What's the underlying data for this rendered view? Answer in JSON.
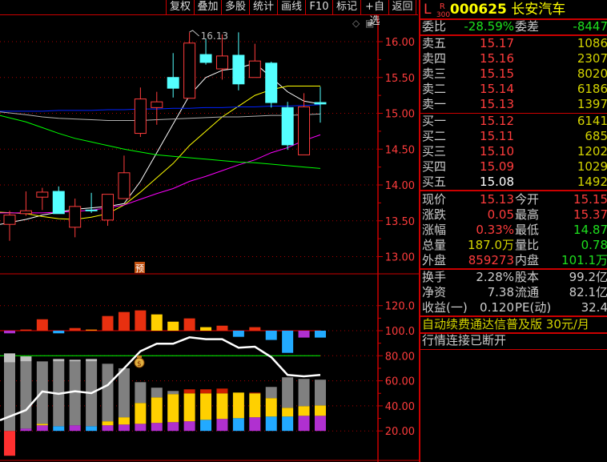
{
  "toolbar": {
    "buttons": [
      "复权",
      "叠加",
      "多股",
      "统计",
      "画线",
      "F10",
      "标记",
      "+自选",
      "返回"
    ]
  },
  "chart_icons": {
    "diamond": "◇",
    "layout": "▣"
  },
  "quote": {
    "prefix_l": "L",
    "prefix_r": "R",
    "prefix_300": "300",
    "code": "000625",
    "name": "长安汽车",
    "weibi_label": "委比",
    "weibi": "-28.59%",
    "weicha_label": "委差",
    "weicha": "-8447",
    "asks": [
      {
        "label": "卖五",
        "price": "15.17",
        "vol": "1086"
      },
      {
        "label": "卖四",
        "price": "15.16",
        "vol": "2307"
      },
      {
        "label": "卖三",
        "price": "15.15",
        "vol": "8020"
      },
      {
        "label": "卖二",
        "price": "15.14",
        "vol": "6186"
      },
      {
        "label": "卖一",
        "price": "15.13",
        "vol": "1397"
      }
    ],
    "bids": [
      {
        "label": "买一",
        "price": "15.12",
        "vol": "6141"
      },
      {
        "label": "买二",
        "price": "15.11",
        "vol": "685"
      },
      {
        "label": "买三",
        "price": "15.10",
        "vol": "1202"
      },
      {
        "label": "买四",
        "price": "15.09",
        "vol": "1029"
      },
      {
        "label": "买五",
        "price": "15.08",
        "vol": "1492"
      }
    ],
    "stats": [
      {
        "l1": "现价",
        "v1": "15.13",
        "c1": "red",
        "l2": "今开",
        "v2": "15.15",
        "c2": "red"
      },
      {
        "l1": "涨跌",
        "v1": "0.05",
        "c1": "red",
        "l2": "最高",
        "v2": "15.37",
        "c2": "red"
      },
      {
        "l1": "涨幅",
        "v1": "0.33%",
        "c1": "red",
        "l2": "最低",
        "v2": "14.87",
        "c2": "grn"
      },
      {
        "l1": "总量",
        "v1": "187.0万",
        "c1": "yel",
        "l2": "量比",
        "v2": "0.78",
        "c2": "grn"
      },
      {
        "l1": "外盘",
        "v1": "859273",
        "c1": "red",
        "l2": "内盘",
        "v2": "101.1万",
        "c2": "grn"
      }
    ],
    "finance": [
      {
        "l1": "换手",
        "v1": "2.28%",
        "l2": "股本",
        "v2": "99.2亿"
      },
      {
        "l1": "净资",
        "v1": "7.38",
        "l2": "流通",
        "v2": "82.1亿"
      },
      {
        "l1": "收益(一)",
        "v1": "0.120",
        "l2": "PE(动)",
        "v2": "32.4"
      }
    ],
    "promo": "自动续费通达信普及版  30元/月",
    "status": "行情连接已断开"
  },
  "chart_data": [
    {
      "type": "candlestick",
      "title": "",
      "y_ticks": [
        "16.00",
        "15.50",
        "15.00",
        "14.50",
        "14.00",
        "13.50",
        "13.00"
      ],
      "ylim": [
        12.75,
        16.25
      ],
      "max_label": "16.13",
      "marker": "预",
      "colors": {
        "up": "#ff3c3c",
        "down": "#54ffff",
        "ma5": "#ffffff",
        "ma10": "#ffff00",
        "ma20": "#ff00ff",
        "ma60": "#00ff00",
        "ma_blue": "#0022ff",
        "ma_gray": "#b0b0b0"
      },
      "candles": [
        {
          "o": 13.45,
          "h": 13.64,
          "l": 13.22,
          "c": 13.58
        },
        {
          "o": 13.6,
          "h": 13.91,
          "l": 13.57,
          "c": 13.64
        },
        {
          "o": 13.83,
          "h": 13.96,
          "l": 13.65,
          "c": 13.9
        },
        {
          "o": 13.91,
          "h": 13.98,
          "l": 13.6,
          "c": 13.6
        },
        {
          "o": 13.41,
          "h": 13.81,
          "l": 13.27,
          "c": 13.7
        },
        {
          "o": 13.65,
          "h": 13.89,
          "l": 13.61,
          "c": 13.64
        },
        {
          "o": 13.51,
          "h": 13.87,
          "l": 13.43,
          "c": 13.87
        },
        {
          "o": 13.81,
          "h": 14.41,
          "l": 13.81,
          "c": 14.17
        },
        {
          "o": 14.72,
          "h": 15.36,
          "l": 14.67,
          "c": 15.2
        },
        {
          "o": 15.08,
          "h": 15.3,
          "l": 14.84,
          "c": 15.16
        },
        {
          "o": 15.5,
          "h": 15.84,
          "l": 15.22,
          "c": 15.35
        },
        {
          "o": 15.21,
          "h": 16.13,
          "l": 15.21,
          "c": 15.98
        },
        {
          "o": 15.82,
          "h": 16.04,
          "l": 15.68,
          "c": 15.71
        },
        {
          "o": 15.62,
          "h": 16.1,
          "l": 15.47,
          "c": 15.8
        },
        {
          "o": 15.81,
          "h": 16.13,
          "l": 15.32,
          "c": 15.41
        },
        {
          "o": 15.5,
          "h": 15.97,
          "l": 15.5,
          "c": 15.73
        },
        {
          "o": 15.7,
          "h": 15.72,
          "l": 15.08,
          "c": 15.15
        },
        {
          "o": 15.08,
          "h": 15.16,
          "l": 14.49,
          "c": 14.56
        },
        {
          "o": 14.42,
          "h": 15.28,
          "l": 14.42,
          "c": 15.09
        },
        {
          "o": 15.15,
          "h": 15.37,
          "l": 14.87,
          "c": 15.13
        }
      ],
      "series": [
        {
          "name": "ma5",
          "values": [
            13.45,
            13.52,
            13.58,
            13.62,
            13.66,
            13.68,
            13.7,
            13.74,
            14.05,
            14.45,
            14.85,
            15.25,
            15.5,
            15.6,
            15.63,
            15.7,
            15.5,
            15.3,
            15.17,
            15.13
          ]
        },
        {
          "name": "ma10",
          "values": [
            13.62,
            13.6,
            13.56,
            13.53,
            13.52,
            13.55,
            13.6,
            13.72,
            13.9,
            14.1,
            14.3,
            14.55,
            14.75,
            14.95,
            15.1,
            15.25,
            15.33,
            15.38,
            15.38,
            15.38
          ]
        },
        {
          "name": "ma20",
          "values": [
            13.61,
            13.61,
            13.61,
            13.62,
            13.63,
            13.65,
            13.68,
            13.72,
            13.8,
            13.88,
            13.95,
            14.05,
            14.12,
            14.2,
            14.28,
            14.35,
            14.45,
            14.52,
            14.62,
            14.7
          ]
        },
        {
          "name": "ma60",
          "values": [
            14.97,
            14.88,
            14.8,
            14.72,
            14.65,
            14.6,
            14.55,
            14.5,
            14.46,
            14.42,
            14.4,
            14.38,
            14.36,
            14.34,
            14.32,
            14.31,
            14.29,
            14.27,
            14.25,
            14.23
          ]
        },
        {
          "name": "ma_blue",
          "values": [
            15.03,
            15.03,
            15.03,
            15.04,
            15.04,
            15.04,
            15.05,
            15.05,
            15.06,
            15.06,
            15.07,
            15.07,
            15.08,
            15.08,
            15.09,
            15.09,
            15.1,
            15.1,
            15.11,
            15.12
          ]
        },
        {
          "name": "ma_gray",
          "values": [
            15.02,
            14.98,
            14.95,
            14.93,
            14.92,
            14.91,
            14.9,
            14.9,
            14.9,
            14.91,
            14.92,
            14.93,
            14.94,
            14.95,
            14.95,
            14.96,
            14.97,
            14.97,
            14.98,
            14.99
          ]
        }
      ]
    },
    {
      "type": "bar",
      "y_ticks": [
        "120.0",
        "100.0",
        "80.00",
        "60.00",
        "40.00",
        "20.00"
      ],
      "ylim": [
        0,
        130
      ],
      "reference_lines": [
        100,
        80
      ],
      "top_bars": [
        {
          "v": 97.9,
          "c": "purple"
        },
        {
          "v": 100.9,
          "c": "red"
        },
        {
          "v": 109.1,
          "c": "red"
        },
        {
          "v": 97.9,
          "c": "blue"
        },
        {
          "v": 102.1,
          "c": "red"
        },
        {
          "v": 100.9,
          "c": "orange"
        },
        {
          "v": 111.7,
          "c": "red"
        },
        {
          "v": 114.9,
          "c": "red"
        },
        {
          "v": 116.2,
          "c": "red"
        },
        {
          "v": 113.0,
          "c": "yellow"
        },
        {
          "v": 107.2,
          "c": "yellow"
        },
        {
          "v": 109.8,
          "c": "red"
        },
        {
          "v": 102.8,
          "c": "yellow"
        },
        {
          "v": 104.0,
          "c": "red"
        },
        {
          "v": 95.1,
          "c": "blue"
        },
        {
          "v": 102.8,
          "c": "red"
        },
        {
          "v": 92.6,
          "c": "blue"
        },
        {
          "v": 82.3,
          "c": "blue"
        },
        {
          "v": 94.5,
          "c": "purple"
        },
        {
          "v": 94.5,
          "c": "blue"
        }
      ],
      "stacks": [
        {
          "base": 0.2,
          "base_c": "red",
          "yellow": null,
          "cap": null,
          "gray": 74.7,
          "light": 81.9
        },
        {
          "base": 21.9,
          "base_c": "purple",
          "yellow": null,
          "cap": null,
          "gray": 75.5,
          "light": 79.5
        },
        {
          "base": 24.5,
          "base_c": "purple",
          "yellow": 25.7,
          "cap": null,
          "gray": 75.5,
          "light": null
        },
        {
          "base": 23.8,
          "base_c": "blue",
          "yellow": null,
          "cap": null,
          "gray": 75.5,
          "light": 77.4
        },
        {
          "base": 24.5,
          "base_c": "purple",
          "yellow": null,
          "cap": null,
          "gray": 75.5,
          "light": 76.8
        },
        {
          "base": 23.8,
          "base_c": "blue",
          "yellow": null,
          "cap": null,
          "gray": 75.5,
          "light": 77.4
        },
        {
          "base": 24.5,
          "base_c": "purple",
          "yellow": 27.7,
          "cap": null,
          "gray": 73.6,
          "light": null
        },
        {
          "base": 25.1,
          "base_c": "purple",
          "yellow": 30.9,
          "cap": null,
          "gray": 70.0,
          "light": null
        },
        {
          "base": 25.7,
          "base_c": "purple",
          "yellow": 42.3,
          "cap": null,
          "gray": 58.9,
          "light": null
        },
        {
          "base": 26.4,
          "base_c": "purple",
          "yellow": 46.8,
          "cap": null,
          "gray": 54.5,
          "light": null
        },
        {
          "base": 27.0,
          "base_c": "purple",
          "yellow": 49.4,
          "cap": null,
          "gray": 51.9,
          "light": null
        },
        {
          "base": 27.7,
          "base_c": "purple",
          "yellow": 50.0,
          "cap": 53.2,
          "gray": null,
          "light": null
        },
        {
          "base": 28.9,
          "base_c": "blue",
          "yellow": 50.0,
          "cap": 53.2,
          "gray": null,
          "light": null
        },
        {
          "base": 29.6,
          "base_c": "purple",
          "yellow": 50.0,
          "cap": 53.8,
          "gray": null,
          "light": null
        },
        {
          "base": 30.2,
          "base_c": "blue",
          "yellow": 50.6,
          "cap": null,
          "gray": null,
          "light": null
        },
        {
          "base": 30.9,
          "base_c": "purple",
          "yellow": 50.0,
          "cap": 50.6,
          "gray": null,
          "light": null
        },
        {
          "base": 31.5,
          "base_c": "blue",
          "yellow": 46.2,
          "cap": null,
          "gray": 55.1,
          "light": null
        },
        {
          "base": 31.5,
          "base_c": "blue",
          "yellow": 38.5,
          "cap": null,
          "gray": 62.8,
          "light": null
        },
        {
          "base": 32.1,
          "base_c": "purple",
          "yellow": 39.8,
          "cap": null,
          "gray": 61.5,
          "light": null
        },
        {
          "base": 32.1,
          "base_c": "purple",
          "yellow": 40.4,
          "cap": null,
          "gray": 60.9,
          "light": null
        }
      ],
      "line": {
        "name": "white-line",
        "values": [
          28.5,
          36.6,
          51.5,
          49.6,
          51.7,
          50.2,
          56.6,
          70.0,
          83.6,
          89.6,
          89.6,
          94.7,
          93.2,
          93.2,
          86.4,
          87.2,
          78.9,
          64.7,
          63.6,
          64.7
        ]
      },
      "signal_icon": "money-bag"
    }
  ]
}
